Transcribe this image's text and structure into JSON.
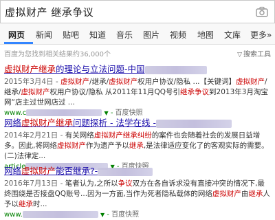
{
  "search": {
    "query": "虚拟财产 继承争议"
  },
  "tabs": [
    {
      "label": "网页"
    },
    {
      "label": "新闻"
    },
    {
      "label": "贴吧"
    },
    {
      "label": "知道"
    },
    {
      "label": "音乐"
    },
    {
      "label": "图片"
    },
    {
      "label": "视频"
    },
    {
      "label": "地图"
    },
    {
      "label": "文库"
    },
    {
      "label": "更多»"
    }
  ],
  "meta": {
    "result_count": "百度为您找到相关结果约36,000个",
    "filter": "搜索工具"
  },
  "results": [
    {
      "title_pre": "",
      "title_em": "虚拟财产继承",
      "title_post": "的理论与立法问题-中国",
      "snippet": [
        {
          "t": "2015年3月4日 - ",
          "c": "date"
        },
        {
          "t": "虚拟财产",
          "c": "em"
        },
        {
          "t": "/继承/",
          "c": ""
        },
        {
          "t": "虚拟财产",
          "c": "em"
        },
        {
          "t": "权用户协议/隐私 ...【关键词】",
          "c": ""
        },
        {
          "t": "虚拟财产",
          "c": "em"
        },
        {
          "t": "/继承/",
          "c": ""
        },
        {
          "t": "虚拟财产",
          "c": "em"
        },
        {
          "t": "权用户协议/隐私 从2011年11月QQ号引",
          "c": ""
        },
        {
          "t": "继承争议",
          "c": "em"
        },
        {
          "t": "到2013年3月淘宝网“店主过世网店过 ...",
          "c": ""
        }
      ],
      "url": "www.c",
      "snapshot": "百度快照"
    },
    {
      "title_pre": "网络",
      "title_em": "虚拟财产继承",
      "title_post": "问题探析 - 法学在线 -",
      "snippet": [
        {
          "t": "2014年2月21日 - ",
          "c": "date"
        },
        {
          "t": "有关网络",
          "c": ""
        },
        {
          "t": "虚拟财产继承纠纷",
          "c": "em"
        },
        {
          "t": "的案件也会随着社会的发展日益增多。因此,将网络",
          "c": ""
        },
        {
          "t": "虚拟财产",
          "c": "em"
        },
        {
          "t": "作为遗产予以",
          "c": ""
        },
        {
          "t": "继承",
          "c": "em"
        },
        {
          "t": ",是法律适应变化了的客观实际的需要。 (二)法律定...",
          "c": ""
        }
      ],
      "url": "article",
      "snapshot": "百度快照"
    },
    {
      "title_pre": "网络",
      "title_em": "虚拟财产",
      "title_post": "能否继承?-",
      "snippet": [
        {
          "t": "2016年7月13日 - ",
          "c": "date"
        },
        {
          "t": "笔者认为,之所以",
          "c": ""
        },
        {
          "t": "争议",
          "c": "em"
        },
        {
          "t": "双方在各自诉求没有直接冲突的情况下,最终围绕是否接",
          "c": ""
        },
        {
          "t": "盘QQ账号...因为一方面,当作为死者隐私载体的网络",
          "c": ""
        },
        {
          "t": "虚拟财产",
          "c": "em"
        },
        {
          "t": "由",
          "c": ""
        },
        {
          "t": "继承",
          "c": "em"
        },
        {
          "t": "人予以",
          "c": ""
        },
        {
          "t": "继承",
          "c": "em"
        },
        {
          "t": "时...",
          "c": ""
        }
      ],
      "url": "www.",
      "snapshot": "百度快照"
    }
  ]
}
